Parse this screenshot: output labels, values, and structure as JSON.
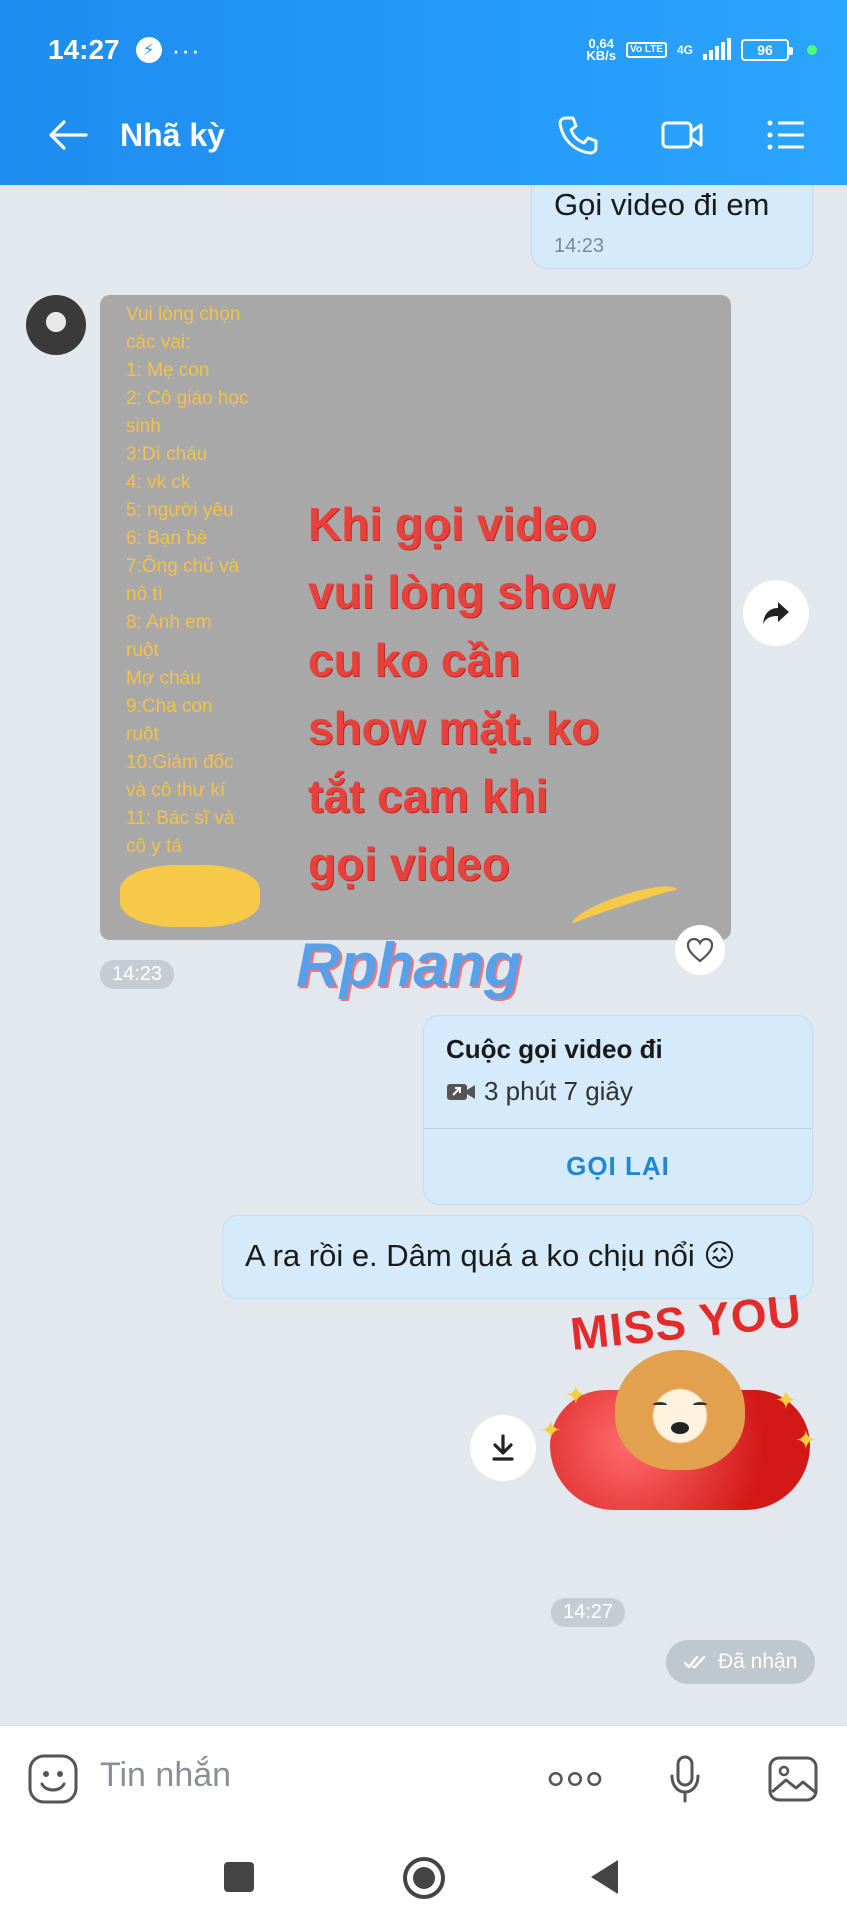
{
  "status_bar": {
    "time": "14:27",
    "speed_value": "0,64",
    "speed_unit": "KB/s",
    "volte": "Vo LTE",
    "network": "4G",
    "battery": "96"
  },
  "header": {
    "title": "Nhã kỳ",
    "icons": [
      "back-arrow-icon",
      "phone-icon",
      "video-camera-icon",
      "menu-list-icon"
    ]
  },
  "messages": {
    "out_text_1": "Gọi video đi em",
    "out_text_1_time": "14:23",
    "image_list": [
      "Vui lòng chọn",
      "các vai:",
      "1: Mẹ con",
      "2: Cô giáo học",
      "sinh",
      "3:Dì cháu",
      "4: vk ck",
      "5: người yêu",
      "6: Bạn bè",
      "7:Ông chủ và",
      "nô tì",
      "8: Anh em",
      "ruột",
      "Mợ cháu",
      "9:Cha con",
      "ruột",
      "10:Giám đốc",
      "và cô thư kí",
      "11: Bác sĩ và",
      "cô y tá"
    ],
    "image_big_text": [
      "Khi gọi video",
      "vui lòng show",
      "cu ko cần",
      "show mặt. ko",
      "tắt cam khi",
      "gọi video"
    ],
    "image_time": "14:23",
    "watermark": "Rphang",
    "call_title": "Cuộc gọi video đi",
    "call_duration": "3 phút 7 giây",
    "call_redial": "GỌI LẠI",
    "out_text_2": "A ra rồi e. Dâm quá a ko chịu nổi 😖",
    "sticker_text": "MISS YOU",
    "sticker_time": "14:27",
    "delivered": "Đã nhận"
  },
  "input": {
    "placeholder": "Tin nhắn"
  },
  "colors": {
    "header_start": "#1e8cf0",
    "header_end": "#2aa5ff",
    "bubble_out": "#d5ebfb",
    "accent": "#1e88d6"
  }
}
